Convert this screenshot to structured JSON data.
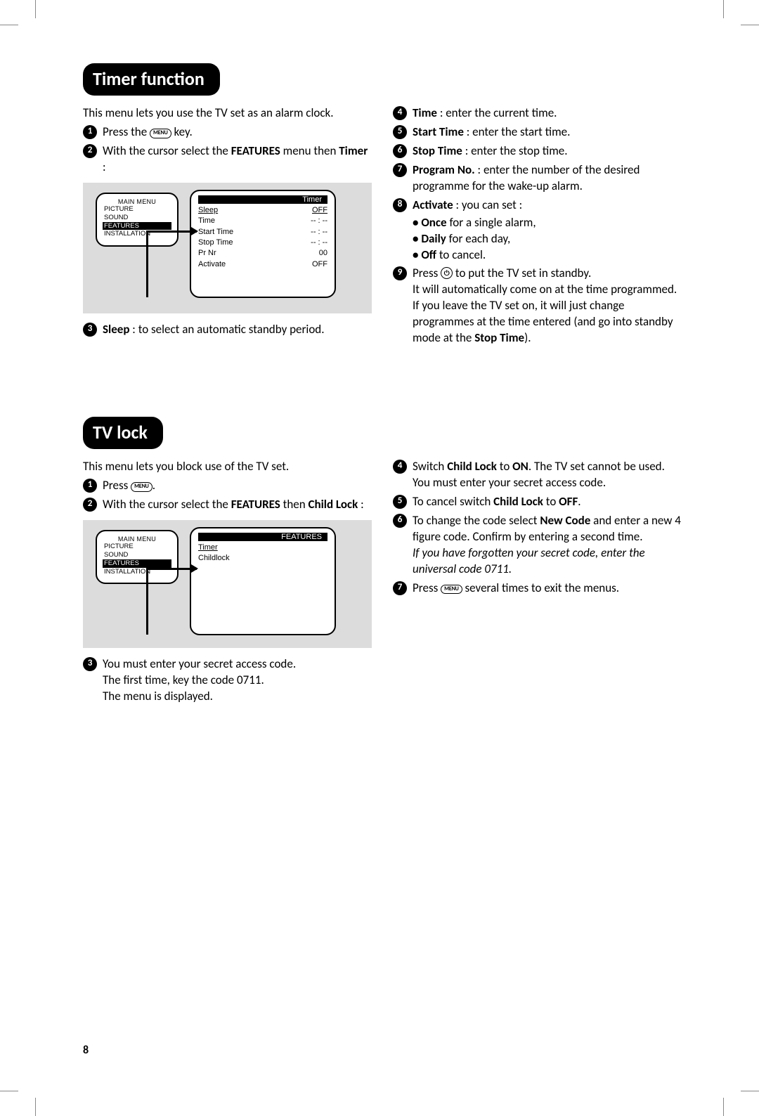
{
  "page_number": "8",
  "s1": {
    "heading": "Timer function",
    "intro": "This menu lets you use the TV set as an alarm clock.",
    "step1": {
      "a": "Press the ",
      "key": "MENU",
      "b": " key."
    },
    "step2": {
      "a": "With the cursor select the ",
      "b": "FEATURES",
      "c": " menu then ",
      "d": "Timer",
      "e": " :"
    },
    "step3": {
      "b": "Sleep",
      "t": " : to select an automatic standby period."
    },
    "step4": {
      "b": "Time",
      "t": " : enter the current time."
    },
    "step5": {
      "b": "Start Time",
      "t": " : enter the start time."
    },
    "step6": {
      "b": "Stop Time",
      "t": " : enter the stop time."
    },
    "step7": {
      "b": "Program No.",
      "t": " : enter the number of the desired programme for the wake-up alarm."
    },
    "step8": {
      "b": "Activate",
      "t": " : you can set :",
      "sb1a": "Once",
      "sb1b": " for a single alarm,",
      "sb2a": "Daily",
      "sb2b": " for each day,",
      "sb3a": "Off",
      "sb3b": " to cancel."
    },
    "step9": {
      "a": "Press ",
      "key": "⏻",
      "b": " to put the TV set in standby.",
      "c": "It will automatically come on at the time programmed. If you leave the TV set on, it will just change programmes at the time entered (and go into standby mode at the ",
      "d": "Stop Time",
      "e": ")."
    },
    "osd": {
      "main_title": "MAIN MENU",
      "main_items": [
        "PICTURE",
        "SOUND",
        "FEATURES",
        "INSTALLATION"
      ],
      "main_sel": 2,
      "sub_title": "Timer",
      "rows": [
        {
          "l": "Sleep",
          "r": "OFF",
          "hl": true
        },
        {
          "l": "Time",
          "r": "-- : --"
        },
        {
          "l": "Start Time",
          "r": "-- : --"
        },
        {
          "l": "Stop Time",
          "r": "-- : --"
        },
        {
          "l": "Pr Nr",
          "r": "00"
        },
        {
          "l": "Activate",
          "r": "OFF"
        }
      ]
    }
  },
  "s2": {
    "heading": "TV lock",
    "intro": "This menu lets you block use of the TV set.",
    "step1": {
      "a": "Press ",
      "key": "MENU",
      "b": "."
    },
    "step2": {
      "a": "With the cursor select the ",
      "b": "FEATURES",
      "c": " then ",
      "d": "Child Lock",
      "e": " :"
    },
    "step3": {
      "a": "You must enter your secret access code.",
      "b": "The first time, key the code 0711.",
      "c": "The menu is displayed."
    },
    "step4": {
      "a": "Switch ",
      "b": "Child Lock",
      "c": " to ",
      "d": "ON",
      "e": ". The TV set cannot be used. You must enter your secret access code."
    },
    "step5": {
      "a": "To cancel switch ",
      "b": "Child Lock",
      "c": " to ",
      "d": "OFF",
      "e": "."
    },
    "step6": {
      "a": "To change the code select ",
      "b": "New Code",
      "c": " and enter a new 4 figure code. Confirm by entering a second time.",
      "it": "If you have forgotten your secret code, enter the universal code 0711."
    },
    "step7": {
      "a": "Press ",
      "key": "MENU",
      "b": " several times to exit the menus."
    },
    "osd": {
      "main_title": "MAIN MENU",
      "main_items": [
        "PICTURE",
        "SOUND",
        "FEATURES",
        "INSTALLATION"
      ],
      "main_sel": 2,
      "sub_title": "FEATURES",
      "rows": [
        {
          "l": "Timer",
          "r": "",
          "hl": true
        },
        {
          "l": "Childlock",
          "r": ""
        }
      ]
    }
  }
}
